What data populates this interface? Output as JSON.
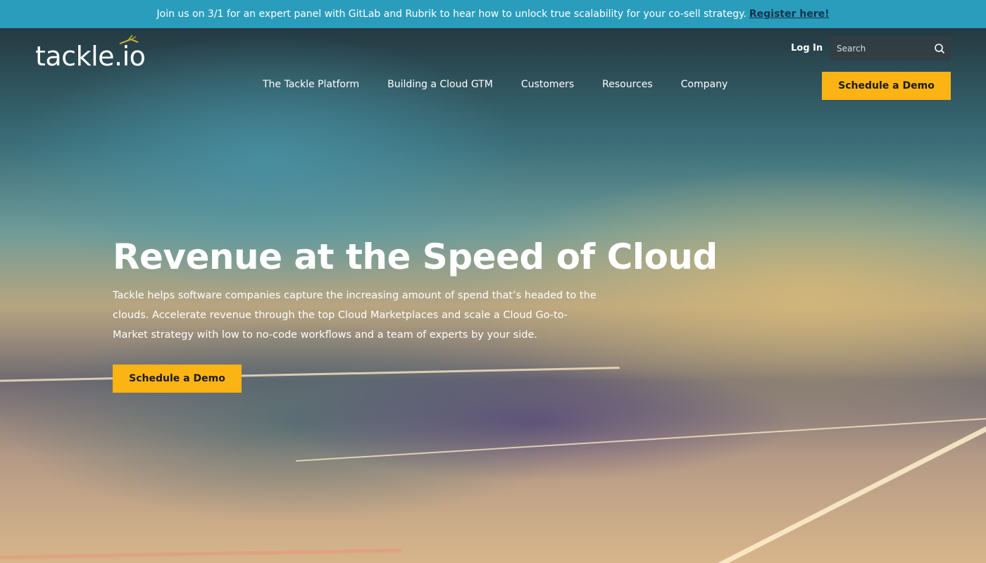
{
  "announcement": {
    "message": "Join us on 3/1 for an expert panel with GitLab and Rubrik to hear how to unlock true scalability for your co-sell strategy.",
    "link_label": "Register here!"
  },
  "header": {
    "logo_text": "tackle.io",
    "login_label": "Log In",
    "search_placeholder": "Search",
    "nav": [
      {
        "label": "The Tackle Platform"
      },
      {
        "label": "Building a Cloud GTM"
      },
      {
        "label": "Customers"
      },
      {
        "label": "Resources"
      },
      {
        "label": "Company"
      }
    ],
    "cta_label": "Schedule a Demo"
  },
  "hero": {
    "title": "Revenue at the Speed of Cloud",
    "description": "Tackle helps software companies capture the increasing amount of spend that’s headed to the clouds. Accelerate revenue through the top Cloud Marketplaces and scale a Cloud Go-to-Market strategy with low to no-code workflows and a team of experts by your side.",
    "cta_label": "Schedule a Demo"
  },
  "colors": {
    "announcement_bg": "#2a9dbd",
    "cta_bg": "#fbb414",
    "link_color": "#14324a"
  },
  "icons": {
    "search": "search-icon",
    "logo_mark": "fly-lure-icon"
  }
}
